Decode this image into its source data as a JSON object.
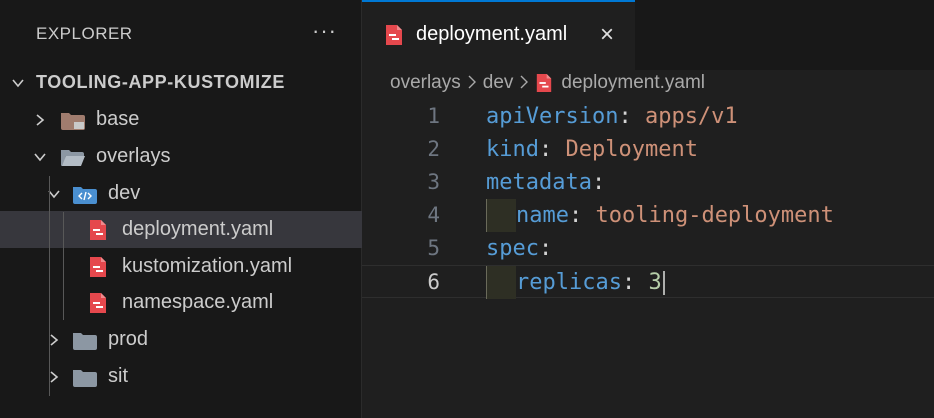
{
  "sidebar": {
    "title": "EXPLORER",
    "more_icon": "···",
    "root_label": "TOOLING-APP-KUSTOMIZE",
    "items": [
      {
        "label": "base",
        "type": "folder",
        "state": "collapsed"
      },
      {
        "label": "overlays",
        "type": "folder",
        "state": "expanded"
      },
      {
        "label": "dev",
        "type": "folder",
        "state": "expanded"
      },
      {
        "label": "deployment.yaml",
        "type": "yaml-file",
        "selected": true
      },
      {
        "label": "kustomization.yaml",
        "type": "yaml-file"
      },
      {
        "label": "namespace.yaml",
        "type": "yaml-file"
      },
      {
        "label": "prod",
        "type": "folder",
        "state": "collapsed"
      },
      {
        "label": "sit",
        "type": "folder",
        "state": "collapsed"
      }
    ]
  },
  "tab": {
    "label": "deployment.yaml",
    "close_icon": "×"
  },
  "breadcrumbs": [
    "overlays",
    "dev",
    "deployment.yaml"
  ],
  "editor": {
    "active_line": 6,
    "lines": [
      {
        "num": "1",
        "key": "apiVersion",
        "colon": ":",
        "value": "apps/v1"
      },
      {
        "num": "2",
        "key": "kind",
        "colon": ":",
        "value": "Deployment"
      },
      {
        "num": "3",
        "key": "metadata",
        "colon": ":",
        "value": ""
      },
      {
        "num": "4",
        "key": "name",
        "colon": ":",
        "value": "tooling-deployment"
      },
      {
        "num": "5",
        "key": "spec",
        "colon": ":",
        "value": ""
      },
      {
        "num": "6",
        "key": "replicas",
        "colon": ":",
        "value": "3"
      }
    ]
  },
  "colors": {
    "yaml_icon": "#e5484d",
    "folder_icon": "#8c97a3",
    "base_folder_icon": "#a07c6e",
    "dev_folder_icon": "#4a8fd0",
    "yaml_key": "#569cd6",
    "yaml_string": "#ce9178",
    "yaml_number": "#b5cea8"
  }
}
